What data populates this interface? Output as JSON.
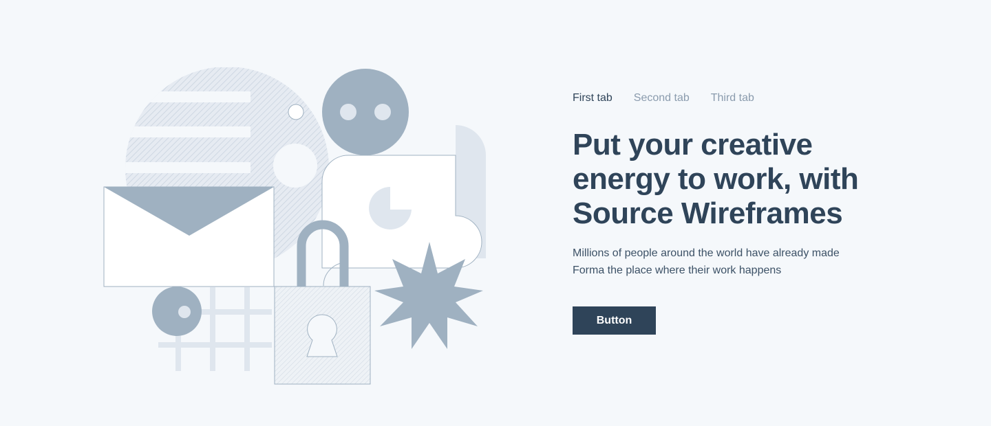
{
  "tabs": [
    {
      "label": "First tab",
      "active": true
    },
    {
      "label": "Second tab",
      "active": false
    },
    {
      "label": "Third tab",
      "active": false
    }
  ],
  "hero": {
    "headline": "Put your creative energy to work, with Source Wireframes",
    "description": "Millions of people around the world have already made Forma the place where their work happens",
    "button_label": "Button"
  },
  "colors": {
    "background": "#f5f8fb",
    "primary": "#2f4459",
    "muted_text": "#8a9bad",
    "shape_dark": "#9fb1c1",
    "shape_light": "#dfe6ee"
  },
  "illustration": {
    "icons": [
      "envelope-icon",
      "lock-icon",
      "chart-card-icon",
      "star-burst-icon",
      "face-circle-icon",
      "grid-icon"
    ]
  }
}
